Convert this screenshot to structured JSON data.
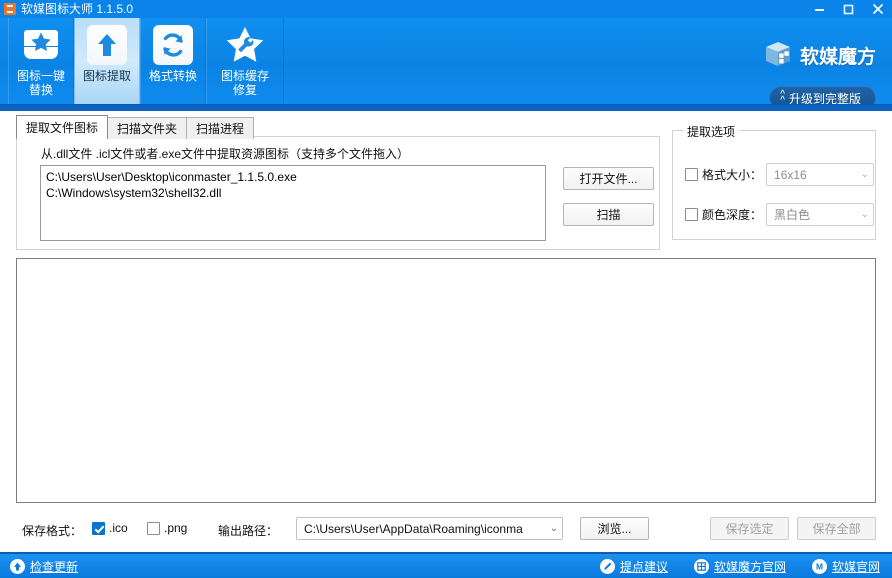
{
  "window": {
    "title": "软媒图标大师 1.1.5.0",
    "app_icon": "app-icon",
    "minimize_label": "—",
    "maximize_label": "□",
    "close_label": "✕"
  },
  "toolbar": {
    "items": [
      {
        "label": "图标一键\n替换",
        "icon": "star-replace-icon",
        "active": false
      },
      {
        "label": "图标提取",
        "icon": "up-arrow-extract-icon",
        "active": true
      },
      {
        "label": "格式转换",
        "icon": "refresh-convert-icon",
        "active": false
      },
      {
        "label": "图标缓存\n修复",
        "icon": "star-wrench-repair-icon",
        "active": false
      }
    ]
  },
  "brand": {
    "name": "软媒魔方",
    "logo_icon": "cube-logo-icon",
    "upgrade_label": "升级到完整版",
    "upgrade_icon": "chevron-up-double-icon"
  },
  "tabs": [
    {
      "label": "提取文件图标",
      "active": true
    },
    {
      "label": "扫描文件夹",
      "active": false
    },
    {
      "label": "扫描进程",
      "active": false
    }
  ],
  "extract_panel": {
    "hint": "从.dll文件 .icl文件或者.exe文件中提取资源图标（支持多个文件拖入）",
    "files": [
      "C:\\Users\\User\\Desktop\\iconmaster_1.1.5.0.exe",
      "C:\\Windows\\system32\\shell32.dll"
    ],
    "open_button": "打开文件...",
    "scan_button": "扫描"
  },
  "options_panel": {
    "legend": "提取选项",
    "size": {
      "label": "格式大小：",
      "checked": false,
      "value": "16x16",
      "enabled": false
    },
    "depth": {
      "label": "颜色深度：",
      "checked": false,
      "value": "黑白色",
      "enabled": false
    }
  },
  "results": {
    "items": []
  },
  "bottom": {
    "save_format_label": "保存格式：",
    "ico_label": ".ico",
    "ico_checked": true,
    "png_label": ".png",
    "png_checked": false,
    "output_path_label": "输出路径：",
    "output_path_value": "C:\\Users\\User\\AppData\\Roaming\\iconma",
    "browse_button": "浏览...",
    "save_selected_button": "保存选定",
    "save_selected_enabled": false,
    "save_all_button": "保存全部",
    "save_all_enabled": false
  },
  "statusbar": {
    "update_link": "检查更新",
    "update_icon": "up-arrow-circle-icon",
    "links": [
      {
        "label": "提点建议",
        "icon": "pencil-circle-icon"
      },
      {
        "label": "软媒魔方官网",
        "icon": "grid-circle-icon"
      },
      {
        "label": "软媒官网",
        "icon": "m-circle-icon"
      }
    ]
  },
  "colors": {
    "titlebar": "#0a84e8",
    "toolbar": "#0f8bee",
    "accent": "#0a74d4",
    "statusbar": "#0b7ade",
    "active_tab_bg": "#cfeafc"
  }
}
